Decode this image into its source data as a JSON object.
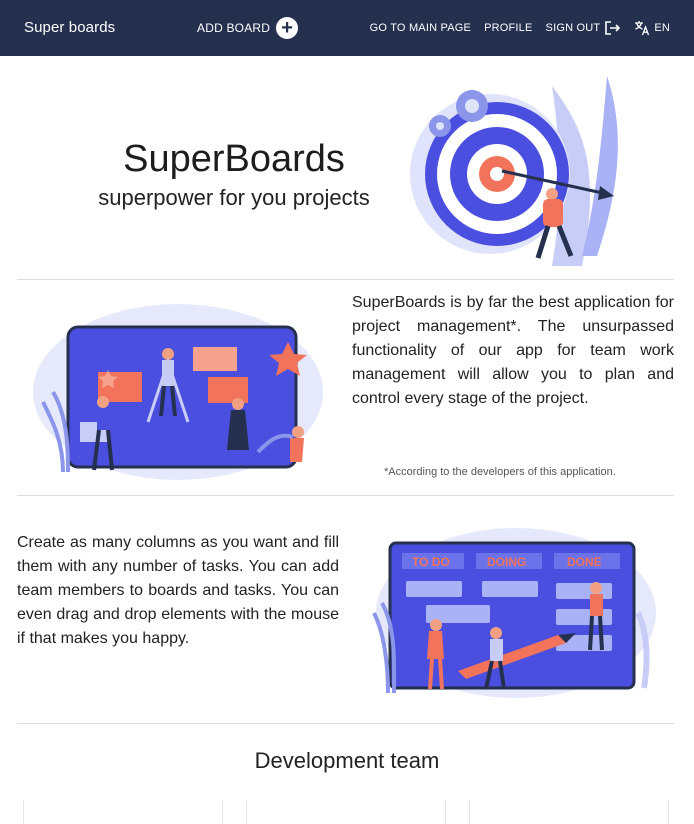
{
  "header": {
    "brand": "Super boards",
    "add_board": "ADD BOARD",
    "add_board_icon": "plus-circle-icon",
    "nav": {
      "main_page": "GO TO MAIN PAGE",
      "profile": "PROFILE",
      "sign_out": "SIGN OUT",
      "sign_out_icon": "logout-icon",
      "language": "EN",
      "language_icon": "translate-icon"
    }
  },
  "hero": {
    "title": "SuperBoards",
    "subtitle": "superpower for you projects"
  },
  "section1": {
    "text": "SuperBoards is by far the best application for project management*. The unsurpassed functionality of our app for team work management will allow you to plan and control every stage of the project.",
    "footnote": "*According to the developers of this application."
  },
  "section2": {
    "text": "Create as many columns as you want and fill them with any number of tasks. You can add team members to boards and tasks. You can even drag and drop elements with the mouse if that makes you happy.",
    "board_columns": [
      "TO DO",
      "DOING",
      "DONE"
    ]
  },
  "team": {
    "title": "Development team"
  },
  "colors": {
    "header_bg": "#25304f",
    "accent_blue": "#4b4fe0",
    "accent_coral": "#f2735b"
  }
}
